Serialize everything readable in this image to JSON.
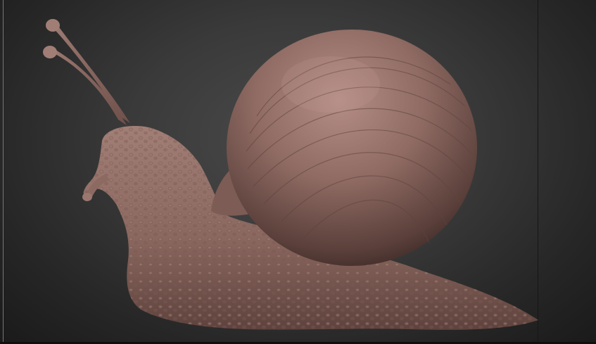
{
  "viewport": {
    "model": "snail-sculpt",
    "material_color": "#8e6a62",
    "background_center": "#4a4a4a",
    "background_edge": "#1a1a1a"
  }
}
